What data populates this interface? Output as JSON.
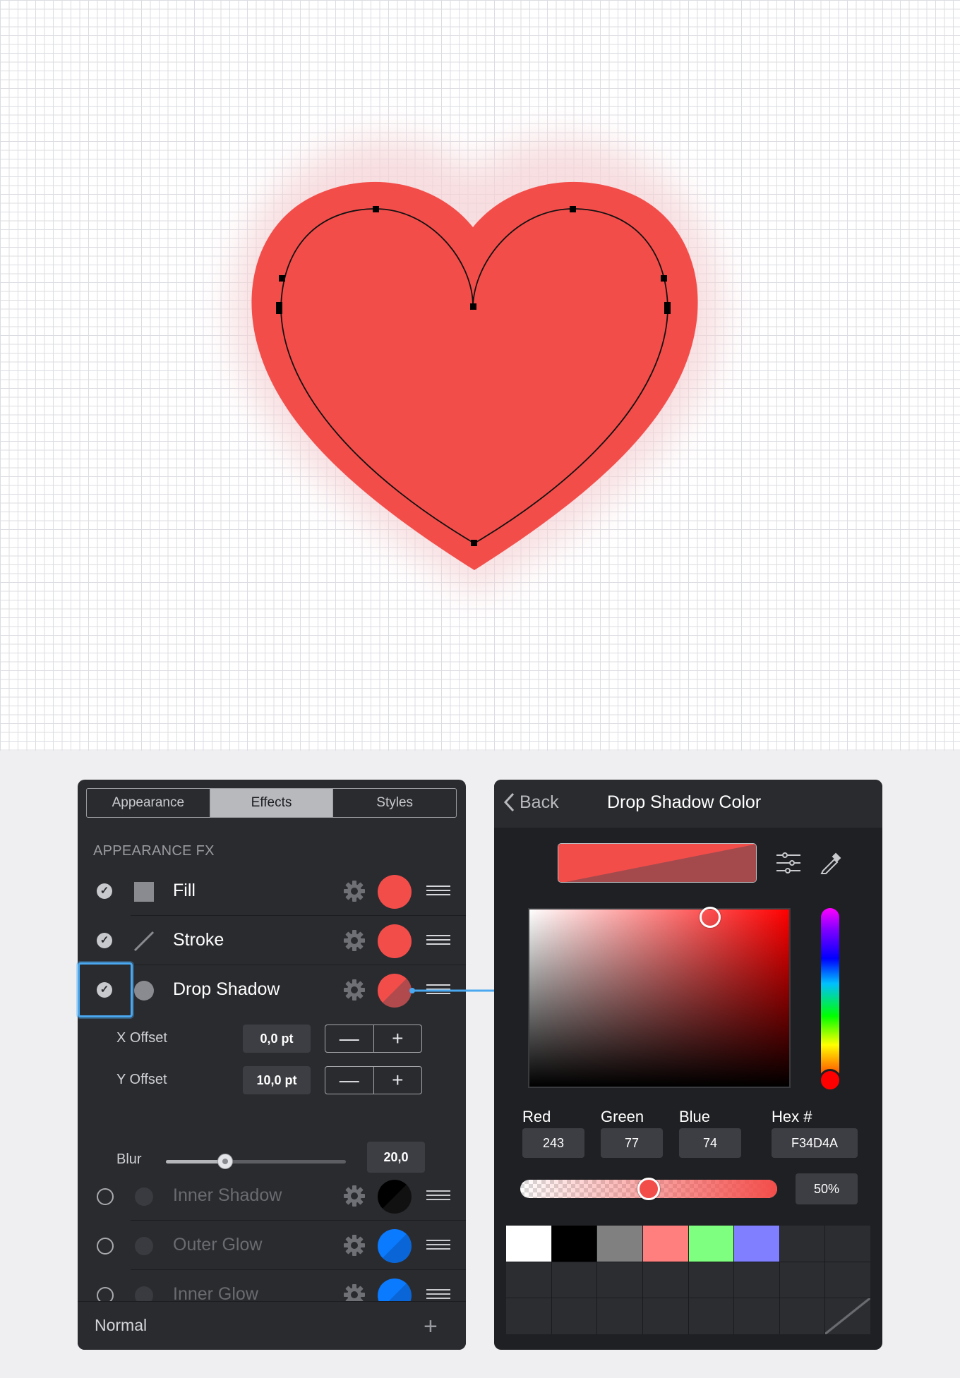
{
  "canvas": {
    "shape": "heart",
    "fill_color": "#F34D4A",
    "shadow_color": "#F34D4A"
  },
  "appearance_panel": {
    "tabs": [
      {
        "label": "Appearance",
        "active": false
      },
      {
        "label": "Effects",
        "active": true
      },
      {
        "label": "Styles",
        "active": false
      }
    ],
    "section_title": "APPEARANCE FX",
    "rows": [
      {
        "label": "Fill",
        "checked": true,
        "icon": "square-icon",
        "swatch": "#F34D4A"
      },
      {
        "label": "Stroke",
        "checked": true,
        "icon": "line-icon",
        "swatch": "#F34D4A"
      },
      {
        "label": "Drop Shadow",
        "checked": true,
        "icon": "circle-icon",
        "swatch": "#F34D4A"
      }
    ],
    "drop_shadow": {
      "x_offset_label": "X Offset",
      "x_offset_value": "0,0 pt",
      "y_offset_label": "Y Offset",
      "y_offset_value": "10,0 pt",
      "blur_label": "Blur",
      "blur_value": "20,0",
      "blur_fraction": 0.33,
      "minus": "—",
      "plus": "+"
    },
    "disabled_rows": [
      {
        "label": "Inner Shadow",
        "checked": false,
        "swatch": "#000000"
      },
      {
        "label": "Outer Glow",
        "checked": false,
        "swatch": "#0A7AFF"
      },
      {
        "label": "Inner Glow",
        "checked": false,
        "swatch": "#0A7AFF"
      }
    ],
    "footer": {
      "blend_mode": "Normal",
      "add": "+"
    }
  },
  "color_panel": {
    "back_label": "Back",
    "title": "Drop Shadow Color",
    "channels": [
      {
        "label": "Red",
        "value": "243"
      },
      {
        "label": "Green",
        "value": "77"
      },
      {
        "label": "Blue",
        "value": "74"
      },
      {
        "label": "Hex #",
        "value": "F34D4A"
      }
    ],
    "alpha_value": "50%",
    "alpha_fraction": 0.5,
    "palette": [
      "#FFFFFF",
      "#000000",
      "#808080",
      "#FF7F7F",
      "#7FFF7F",
      "#7F7FFF"
    ]
  }
}
